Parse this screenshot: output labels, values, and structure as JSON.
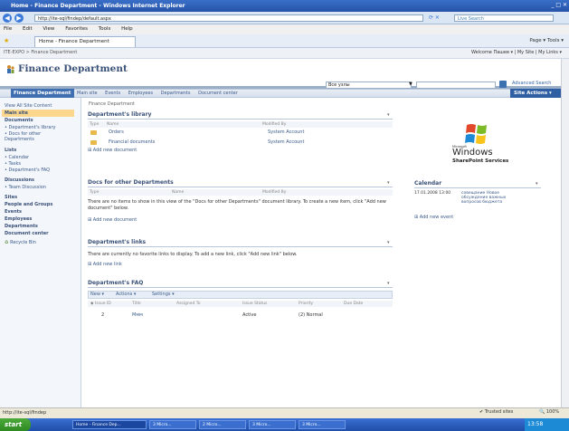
{
  "browser": {
    "window_title": "Home - Finance Department - Windows Internet Explorer",
    "address": "http://ite-sql/findep/default.aspx",
    "search_placeholder": "Live Search",
    "menu": [
      "File",
      "Edit",
      "View",
      "Favorites",
      "Tools",
      "Help"
    ],
    "tab_label": "Home - Finance Department",
    "commands": "Page ▾  Tools ▾",
    "status_left": "http://ite-sql/findep",
    "status_zone": "Trusted sites",
    "zoom": "100%"
  },
  "sharepoint": {
    "site_path": "ITE-EXPO > Finance Department",
    "welcome": "Welcome Пашев ▾ | My Site | My Links ▾",
    "site_title": "Finance Department",
    "search_scope": "Все узлы",
    "advanced_search": "Advanced Search",
    "top_nav_active": "Finance Department",
    "top_nav": [
      "Main site",
      "Events",
      "Employees",
      "Departments",
      "Document center"
    ],
    "site_actions": "Site Actions ▾",
    "left_nav": {
      "view_all": "View All Site Content",
      "main_site": "Main site",
      "documents_h": "Documents",
      "doc_items": [
        "Department's library",
        "Docs for other Departments"
      ],
      "lists_h": "Lists",
      "list_items": [
        "Calendar",
        "Tasks",
        "Department's FAQ"
      ],
      "discussions_h": "Discussions",
      "discussion_items": [
        "Team Discussion"
      ],
      "sites_h": "Sites",
      "people_h": "People and Groups",
      "events_h": "Events",
      "employees_h": "Employees",
      "departments_h": "Departments",
      "doccenter_h": "Document center",
      "recycle": "Recycle Bin"
    },
    "breadcrumb": "Finance Department",
    "library": {
      "title": "Department's library",
      "col_type": "Type",
      "col_name": "Name",
      "col_modified_by": "Modified By",
      "rows": [
        {
          "name": "Orders",
          "modified_by": "System Account"
        },
        {
          "name": "Financial documents",
          "modified_by": "System Account"
        }
      ],
      "add": "Add new document"
    },
    "docs_other": {
      "title": "Docs for other Departments",
      "col_type": "Type",
      "col_name": "Name",
      "col_modified_by": "Modified By",
      "empty_msg": "There are no items to show in this view of the \"Docs for other Departments\" document library. To create a new item, click \"Add new document\" below.",
      "add": "Add new document"
    },
    "links": {
      "title": "Department's links",
      "empty_msg": "There are currently no favorite links to display. To add a new link, click \"Add new link\" below.",
      "add": "Add new link"
    },
    "faq": {
      "title": "Department's FAQ",
      "toolbar": [
        "New ▾",
        "Actions ▾",
        "Settings ▾"
      ],
      "cols": [
        "Issue ID",
        "Title",
        "Assigned To",
        "Issue Status",
        "Priority",
        "Due Date"
      ],
      "row": {
        "id": "2",
        "title": "Ммм",
        "assigned": "",
        "status": "Active",
        "priority": "(2) Normal",
        "due": ""
      }
    },
    "windows_logo": {
      "line1": "Microsoft",
      "line2": "Windows",
      "line3": "SharePoint Services"
    },
    "calendar": {
      "title": "Calendar",
      "event_time": "17.01.2008 13:00",
      "event_text": "совещание Новое обсуждение важных вопросов бюджета",
      "add": "Add new event"
    }
  },
  "taskbar": {
    "start": "start",
    "items": [
      "Home - Finance Dep...",
      "3 Micro...",
      "2 Micro...",
      "3 Micro...",
      "3 Micro..."
    ],
    "clock": "13:58"
  }
}
